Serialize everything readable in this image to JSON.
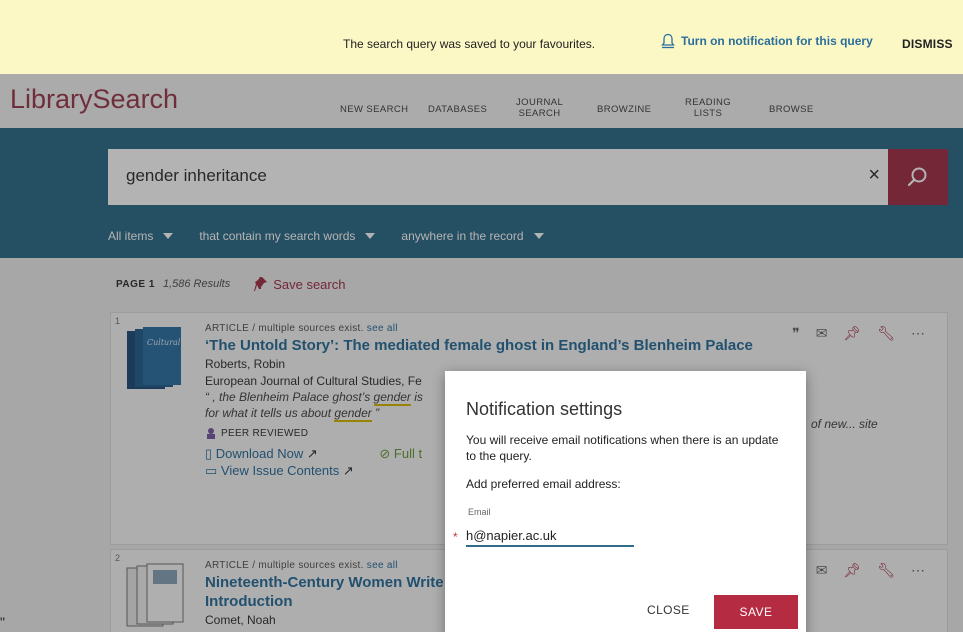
{
  "banner": {
    "message": "The search query was saved to your favourites.",
    "notify_label": "Turn on notification for this query",
    "dismiss_label": "DISMISS"
  },
  "header": {
    "brand": "LibrarySearch",
    "nav": [
      {
        "label": "NEW SEARCH"
      },
      {
        "label": "DATABASES"
      },
      {
        "line1": "JOURNAL",
        "line2": "SEARCH"
      },
      {
        "label": "BROWZINE"
      },
      {
        "line1": "READING",
        "line2": "LISTS"
      },
      {
        "label": "BROWSE"
      }
    ]
  },
  "search": {
    "query": "gender inheritance",
    "clear": "×",
    "filters": [
      "All items",
      "that contain my search words",
      "anywhere in the record"
    ]
  },
  "results": {
    "page_label": "PAGE 1",
    "count": "1,586 Results",
    "save_label": "Save search",
    "items": [
      {
        "num": "1",
        "type": "ARTICLE",
        "sources": "/ multiple sources exist.",
        "see_all": "see all",
        "title": "‘The Untold Story’: The mediated female ghost in England’s Blenheim Palace",
        "author": "Roberts, Robin",
        "source": "European Journal of Cultural Studies, Fe",
        "snippet_a": "“ , the Blenheim Palace ghost’s ",
        "snippet_hl": "gender",
        "snippet_b": " is",
        "snippet_c": "for what it tells us about ",
        "snippet_hl2": "gender",
        "snippet_d": " ”",
        "snippet_right": "of new... site",
        "peer": "PEER REVIEWED",
        "download": "Download Now",
        "fulltext": "Full t",
        "issue": "View Issue Contents"
      },
      {
        "num": "2",
        "type": "ARTICLE",
        "sources": "/ multiple sources exist.",
        "see_all": "see all",
        "title": "Nineteenth-Century Women Write",
        "title2": "Introduction",
        "author": "Comet, Noah"
      }
    ]
  },
  "dialog": {
    "title": "Notification settings",
    "text": "You will receive email notifications when there is an update to the query.",
    "add_label": "Add preferred email address:",
    "email_label": "Email",
    "required": "*",
    "email_value": "h@napier.ac.uk",
    "close_label": "CLOSE",
    "save_label": "SAVE"
  },
  "left_mark": "\""
}
